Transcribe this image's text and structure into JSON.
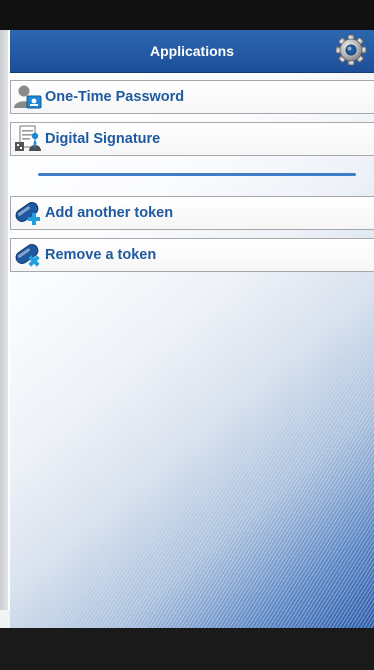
{
  "header": {
    "title": "Applications",
    "settings_icon": "gear-icon"
  },
  "menu": [
    {
      "label": "One-Time Password",
      "icon": "user-token-icon"
    },
    {
      "label": "Digital Signature",
      "icon": "document-signature-icon"
    }
  ],
  "actions": [
    {
      "label": "Add another token",
      "icon": "token-add-icon"
    },
    {
      "label": "Remove a token",
      "icon": "token-remove-icon"
    }
  ],
  "colors": {
    "header_blue": "#1d4f99",
    "label_blue": "#1f5aa0",
    "divider_blue": "#3f7ec6",
    "add_plus": "#1fa0e0",
    "remove_x": "#1fa0e0"
  }
}
